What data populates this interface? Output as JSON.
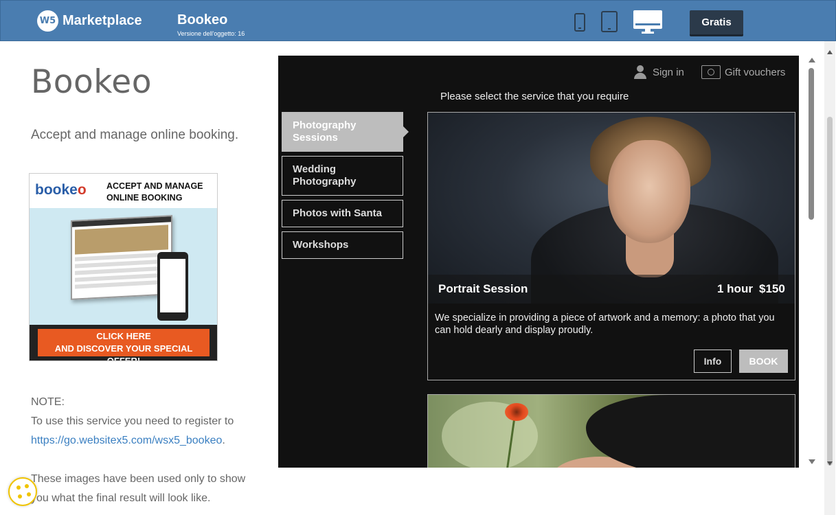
{
  "header": {
    "logo_badge": "W5",
    "brand": "Marketplace",
    "app_title": "Bookeo",
    "version_label": "Versione dell'oggetto: 16",
    "device_icons": [
      "phone-icon",
      "tablet-icon",
      "desktop-icon"
    ],
    "selected_device": "desktop",
    "cta_label": "Gratis",
    "bar_color": "#4a7db0"
  },
  "left": {
    "title": "Bookeo",
    "description": "Accept and manage online booking.",
    "ad": {
      "logo_text": "booke",
      "logo_o": "o",
      "headline_line1": "ACCEPT AND MANAGE",
      "headline_line2": "ONLINE BOOKING",
      "cta_line1": "CLICK HERE",
      "cta_line2": "AND DISCOVER YOUR SPECIAL OFFER!"
    },
    "note_label": "NOTE:",
    "note_text": "To use this service you need to register to",
    "note_link": "https://go.websitex5.com/wsx5_bookeo",
    "note_link_suffix": ".",
    "images_note_line1": "These images have been used only to show",
    "images_note_line2": "you what the final result will look like."
  },
  "widget": {
    "sign_in": "Sign in",
    "gift_vouchers": "Gift vouchers",
    "prompt": "Please select the service that you require",
    "services": [
      {
        "label": "Photography Sessions",
        "active": true
      },
      {
        "label": "Wedding Photography",
        "active": false
      },
      {
        "label": "Photos with Santa",
        "active": false
      },
      {
        "label": "Workshops",
        "active": false
      }
    ],
    "card": {
      "name": "Portrait Session",
      "duration": "1 hour",
      "price": "$150",
      "description": "We specialize in providing a piece of artwork and a memory: a photo that you can hold dearly and display proudly.",
      "info_label": "Info",
      "book_label": "BOOK"
    }
  }
}
